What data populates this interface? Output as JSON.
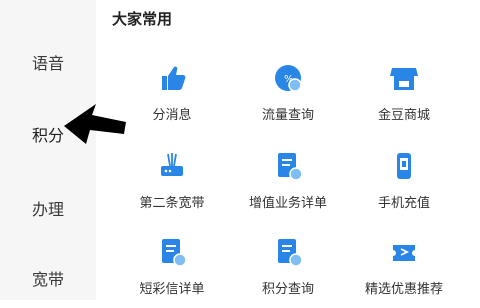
{
  "sidebar": {
    "items": [
      {
        "label": "语音"
      },
      {
        "label": "积分",
        "active": true
      },
      {
        "label": "办理"
      },
      {
        "label": "宽带"
      }
    ]
  },
  "main": {
    "section_title": "大家常用",
    "tiles": [
      {
        "label": "分消息",
        "icon": "thumbs-up-icon"
      },
      {
        "label": "流量查询",
        "icon": "data-usage-icon"
      },
      {
        "label": "金豆商城",
        "icon": "store-icon"
      },
      {
        "label": "第二条宽带",
        "icon": "router-icon"
      },
      {
        "label": "增值业务详单",
        "icon": "document-detail-icon"
      },
      {
        "label": "手机充值",
        "icon": "phone-recharge-icon"
      },
      {
        "label": "短彩信详单",
        "icon": "sms-detail-icon"
      },
      {
        "label": "积分查询",
        "icon": "points-query-icon"
      },
      {
        "label": "精选优惠推荐",
        "icon": "coupon-icon"
      }
    ]
  },
  "colors": {
    "accent": "#2a86e6",
    "sidebar_bg": "#f6f6f6",
    "arrow": "#000000"
  }
}
